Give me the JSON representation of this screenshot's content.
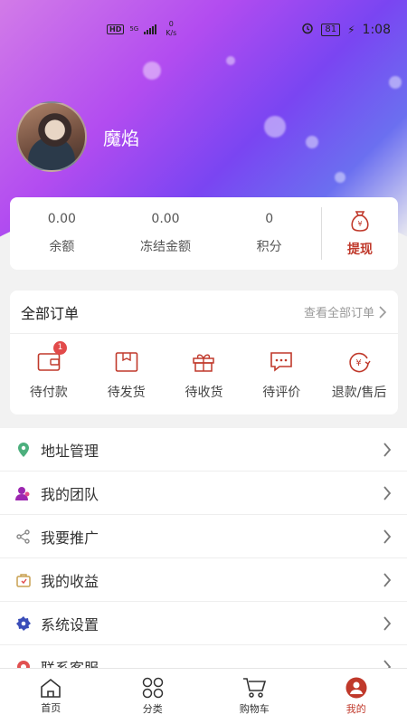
{
  "status_bar": {
    "hd": "HD",
    "network": "5G",
    "speed_value": "0",
    "speed_unit": "K/s",
    "battery": "81",
    "time": "1:08"
  },
  "profile": {
    "username": "魔焰 ￼ ￼"
  },
  "balance": {
    "items": [
      {
        "value": "0.00",
        "label": "余额"
      },
      {
        "value": "0.00",
        "label": "冻结金额"
      },
      {
        "value": "0",
        "label": "积分"
      }
    ],
    "withdraw_label": "提现"
  },
  "orders": {
    "title": "全部订单",
    "view_all": "查看全部订单",
    "items": [
      {
        "label": "待付款",
        "icon": "wallet-icon",
        "badge": "1"
      },
      {
        "label": "待发货",
        "icon": "box-icon"
      },
      {
        "label": "待收货",
        "icon": "gift-icon"
      },
      {
        "label": "待评价",
        "icon": "comment-icon"
      },
      {
        "label": "退款/售后",
        "icon": "refund-icon"
      }
    ]
  },
  "menu": {
    "items": [
      {
        "label": "地址管理",
        "icon": "location-icon",
        "color": "#4caf7d"
      },
      {
        "label": "我的团队",
        "icon": "team-icon",
        "color": "#9c27b0"
      },
      {
        "label": "我要推广",
        "icon": "share-icon",
        "color": "#888888"
      },
      {
        "label": "我的收益",
        "icon": "earnings-icon",
        "color": "#c8a050"
      },
      {
        "label": "系统设置",
        "icon": "settings-icon",
        "color": "#3a4db8"
      },
      {
        "label": "联系客服",
        "icon": "service-icon",
        "color": "#e05050"
      }
    ]
  },
  "tabbar": {
    "items": [
      {
        "label": "首页",
        "icon": "home-icon"
      },
      {
        "label": "分类",
        "icon": "category-icon"
      },
      {
        "label": "购物车",
        "icon": "cart-icon"
      },
      {
        "label": "我的",
        "icon": "user-icon",
        "active": true
      }
    ]
  },
  "colors": {
    "accent": "#c0392b",
    "badge": "#e24a4a"
  }
}
